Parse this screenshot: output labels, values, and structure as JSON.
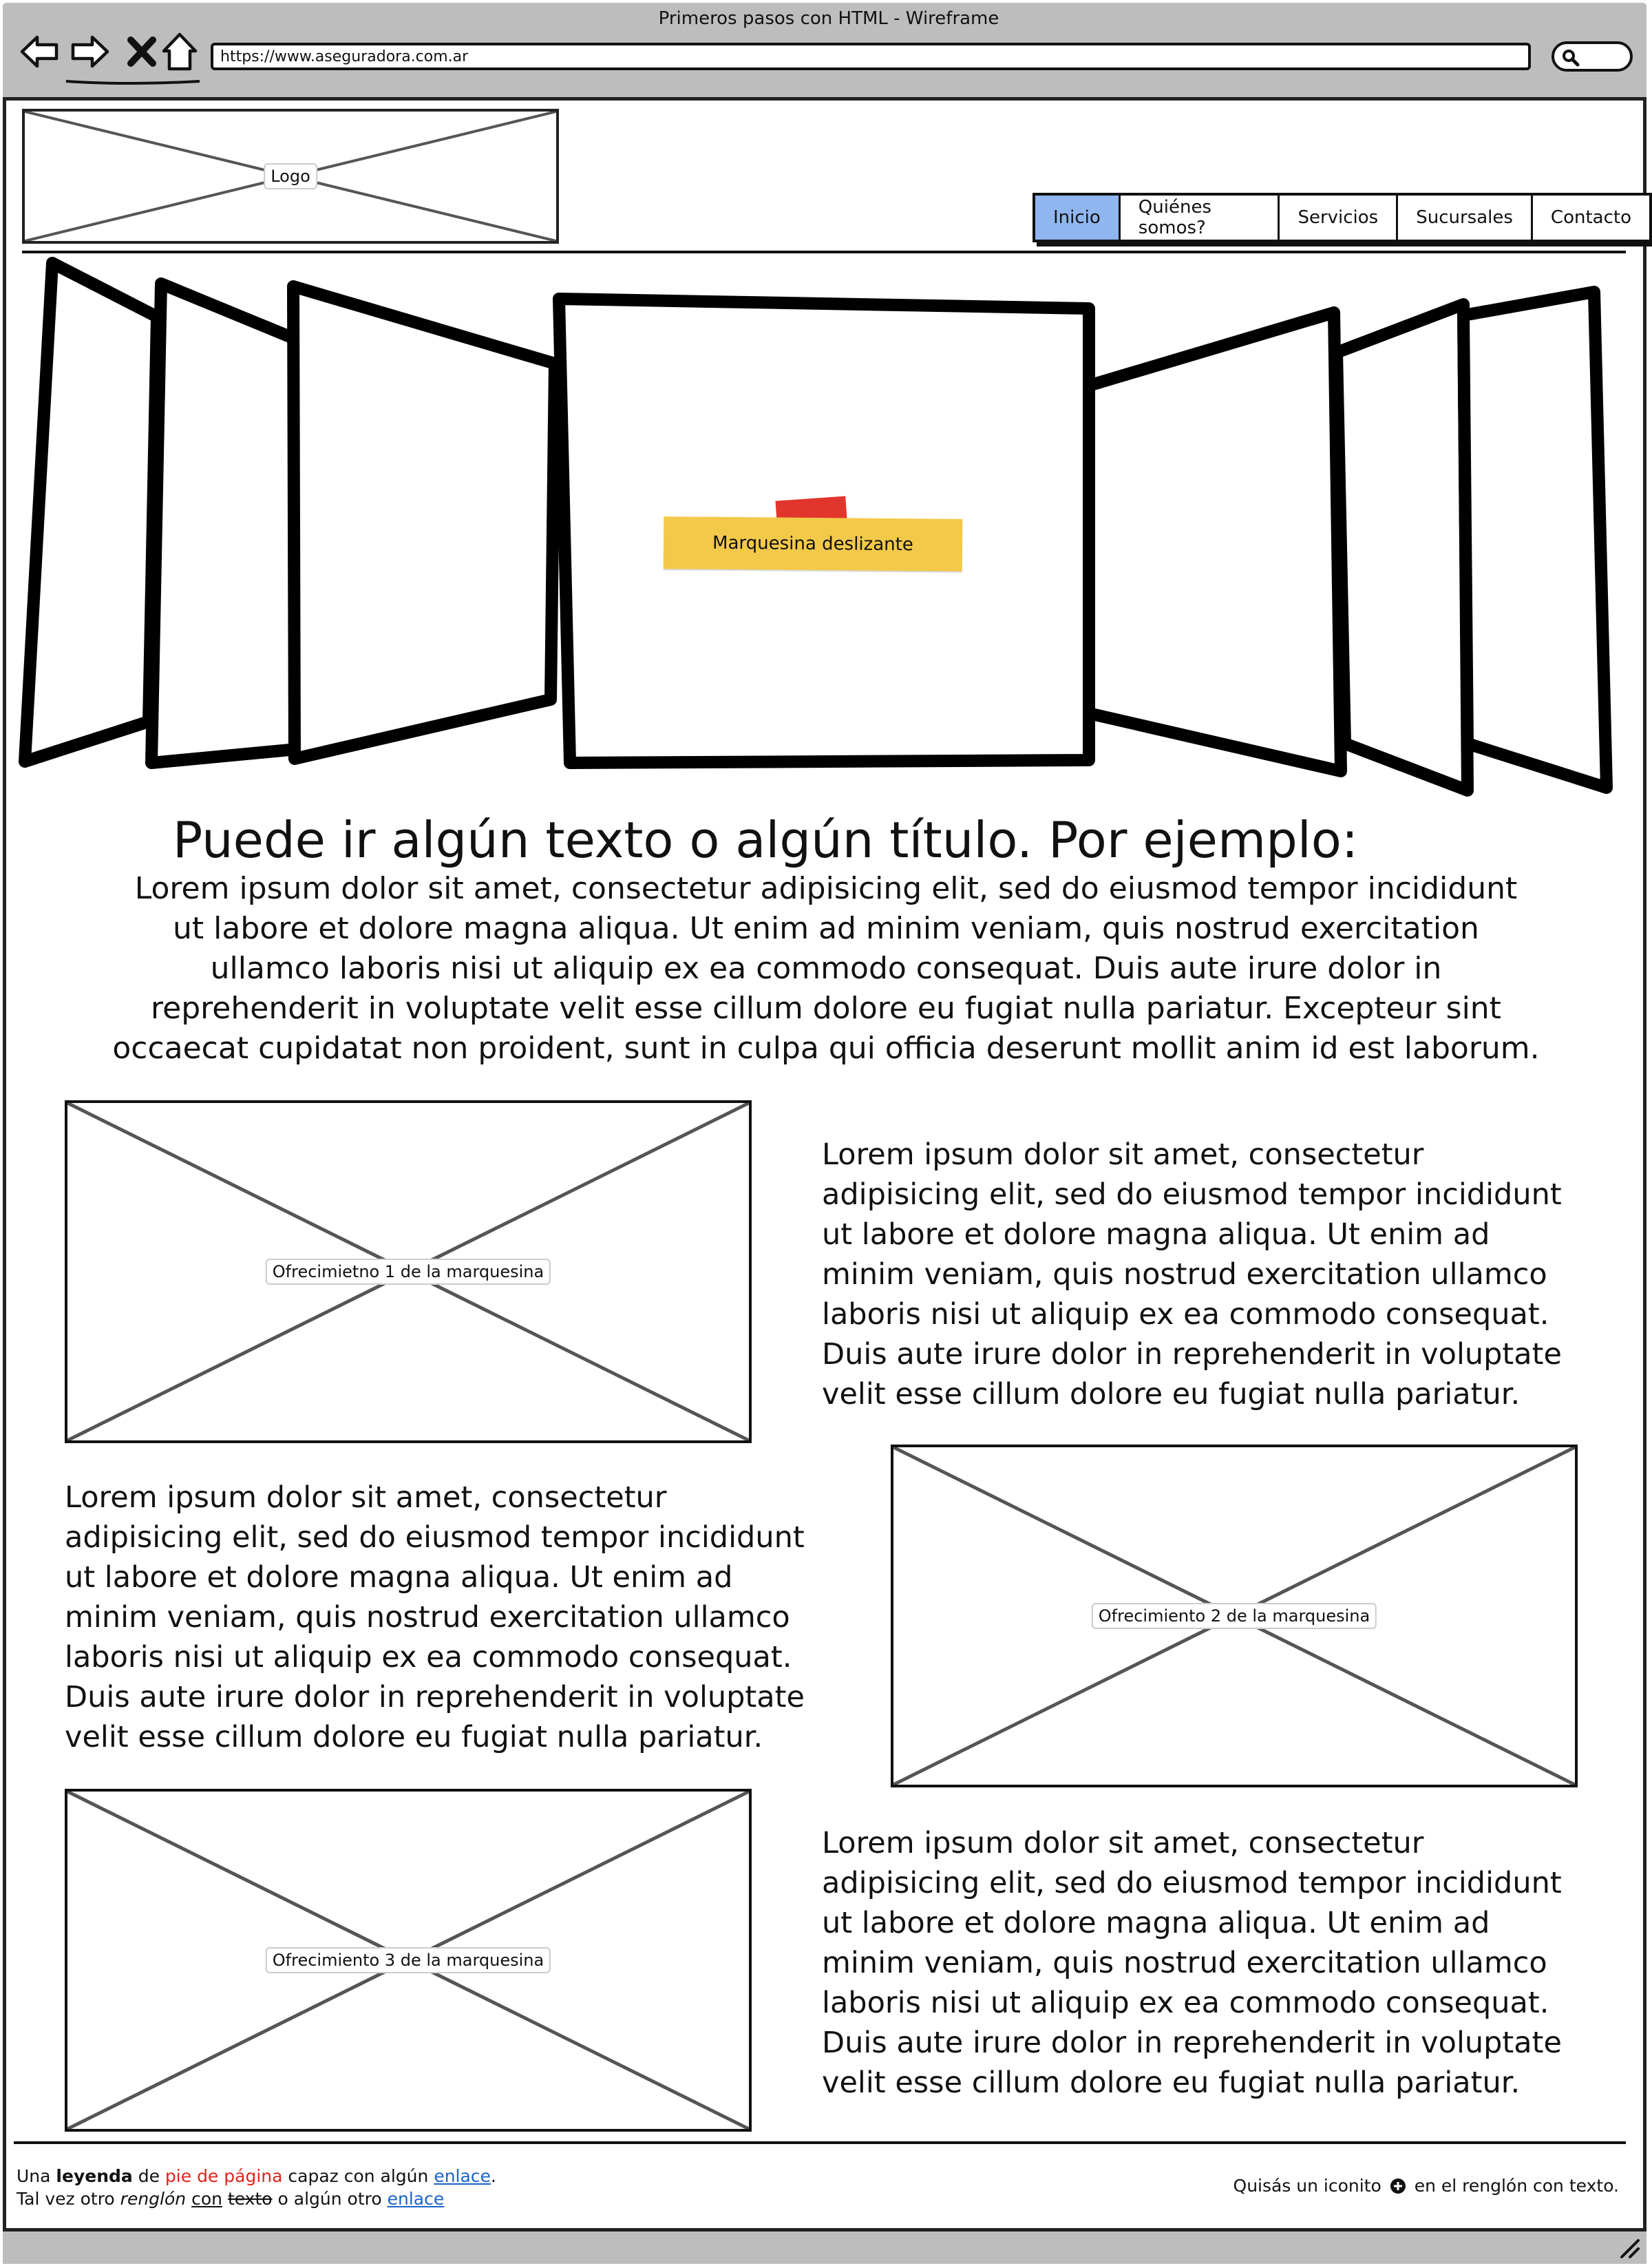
{
  "window": {
    "title": "Primeros pasos con HTML - Wireframe",
    "url": "https://www.aseguradora.com.ar"
  },
  "header": {
    "logo_label": "Logo",
    "nav": [
      {
        "label": "Inicio",
        "active": true
      },
      {
        "label": "Quiénes somos?",
        "active": false
      },
      {
        "label": "Servicios",
        "active": false
      },
      {
        "label": "Sucursales",
        "active": false
      },
      {
        "label": "Contacto",
        "active": false
      }
    ]
  },
  "hero": {
    "label": "Marquesina deslizante"
  },
  "intro": {
    "title": "Puede ir algún texto o algún título. Por ejemplo:",
    "lines": [
      "Lorem ipsum dolor sit amet, consectetur adipisicing elit, sed do eiusmod tempor incididunt",
      "ut labore et dolore magna aliqua. Ut enim ad minim veniam, quis nostrud exercitation",
      "ullamco laboris nisi ut aliquip ex ea commodo consequat. Duis aute irure dolor in",
      "reprehenderit in voluptate velit esse cillum dolore eu fugiat nulla pariatur. Excepteur sint",
      "occaecat cupidatat non proident, sunt in culpa qui officia deserunt mollit anim id est laborum."
    ]
  },
  "offers": [
    {
      "label": "Ofrecimietno 1 de la marquesina"
    },
    {
      "label": "Ofrecimiento 2 de la marquesina"
    },
    {
      "label": "Ofrecimiento 3 de la marquesina"
    }
  ],
  "paragraph_lines": [
    "Lorem ipsum dolor sit amet, consectetur",
    "adipisicing elit, sed do eiusmod tempor incididunt",
    "ut labore et dolore magna aliqua. Ut enim ad",
    "minim veniam, quis nostrud exercitation ullamco",
    "laboris nisi ut aliquip ex ea commodo consequat.",
    "Duis aute irure dolor in reprehenderit in voluptate",
    "velit esse cillum dolore eu fugiat nulla pariatur."
  ],
  "footer": {
    "line1": {
      "t1": "Una ",
      "bold": "leyenda",
      "t2": " de ",
      "red": "pie de página",
      "t3": " capaz con algún ",
      "link": "enlace",
      "t4": "."
    },
    "line2": {
      "t1": "Tal vez otro ",
      "italic": "renglón",
      "t2": " ",
      "underline": "con",
      "t3": " ",
      "strike": "texto",
      "t4": " o algún otro ",
      "link": "enlace"
    },
    "right": {
      "t1": "Quisás un iconito",
      "t2": "en el renglón con texto."
    }
  },
  "icons": {
    "back": "arrow-left-icon",
    "forward": "arrow-right-icon",
    "stop": "close-icon",
    "home": "home-icon",
    "search": "search-icon",
    "plus": "plus-circle-icon",
    "grip": "resize-grip-icon"
  },
  "colors": {
    "active_tab": "#8fb6ef",
    "chrome": "#bdbdbd",
    "sticky_note": "#f3c94a",
    "tape": "#e2352d",
    "footer_red": "#e0241b",
    "link": "#1b64c8"
  }
}
